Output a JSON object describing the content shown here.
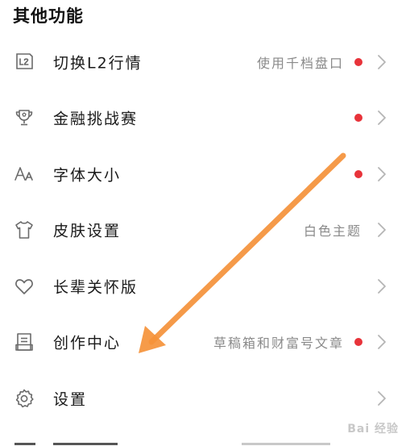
{
  "section": {
    "title": "其他功能"
  },
  "colors": {
    "dot": "#e8333a",
    "arrow": "#f5923a",
    "chevron": "#b5b5b5",
    "icon": "#6a6a6a"
  },
  "menu": {
    "items": [
      {
        "name": "l2",
        "icon": "l2-badge-icon",
        "label": "切换L2行情",
        "value": "使用千档盘口",
        "dot": true
      },
      {
        "name": "contest",
        "icon": "trophy-icon",
        "label": "金融挑战赛",
        "value": "",
        "dot": true
      },
      {
        "name": "font-size",
        "icon": "font-size-icon",
        "label": "字体大小",
        "value": "",
        "dot": true
      },
      {
        "name": "skin",
        "icon": "tshirt-icon",
        "label": "皮肤设置",
        "value": "白色主题",
        "dot": false
      },
      {
        "name": "elder-mode",
        "icon": "heart-icon",
        "label": "长辈关怀版",
        "value": "",
        "dot": false
      },
      {
        "name": "creation-center",
        "icon": "document-icon",
        "label": "创作中心",
        "value": "草稿箱和财富号文章",
        "dot": true
      },
      {
        "name": "settings",
        "icon": "gear-icon",
        "label": "设置",
        "value": "",
        "dot": false
      }
    ]
  },
  "watermark": {
    "text": "Bai 经验"
  }
}
